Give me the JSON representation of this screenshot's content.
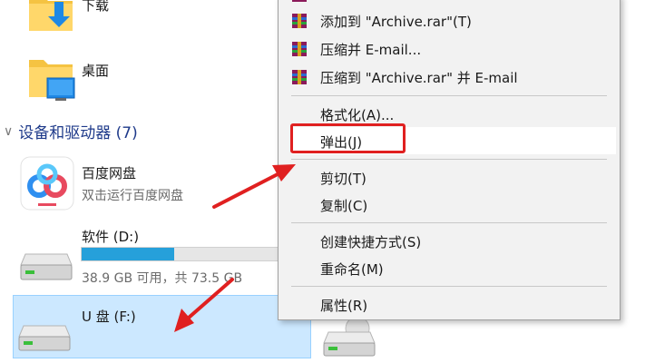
{
  "explorer": {
    "folders": [
      {
        "label": "下载",
        "icon": "download-folder-icon"
      },
      {
        "label": "桌面",
        "icon": "desktop-folder-icon"
      }
    ],
    "group_header": {
      "label": "设备和驱动器 (7)",
      "expanded": true
    },
    "devices": [
      {
        "name": "百度网盘",
        "subtitle": "双击运行百度网盘",
        "icon": "baidu-netdisk-icon"
      },
      {
        "name": "软件 (D:)",
        "usage_text": "38.9 GB 可用，共 73.5 GB",
        "used_fraction": 0.47,
        "icon": "drive-icon"
      },
      {
        "name": "U 盘 (F:)",
        "icon": "usb-drive-icon",
        "selected": true
      }
    ]
  },
  "context_menu": {
    "items": [
      {
        "label": "添加到 \"Archive.rar\"(T)",
        "icon": "winrar-icon"
      },
      {
        "label": "压缩并 E-mail...",
        "icon": "winrar-icon"
      },
      {
        "label": "压缩到 \"Archive.rar\" 并 E-mail",
        "icon": "winrar-icon"
      },
      {
        "label": "格式化(A)..."
      },
      {
        "label": "弹出(J)",
        "highlighted": true
      },
      {
        "label": "剪切(T)"
      },
      {
        "label": "复制(C)"
      },
      {
        "label": "创建快捷方式(S)"
      },
      {
        "label": "重命名(M)"
      },
      {
        "label": "属性(R)"
      }
    ]
  },
  "colors": {
    "menu_bg": "#f2f2f2",
    "selection": "#cce8ff",
    "group_header": "#1e3a8a",
    "usage_bar": "#26a0da",
    "annotation": "#e02020"
  }
}
